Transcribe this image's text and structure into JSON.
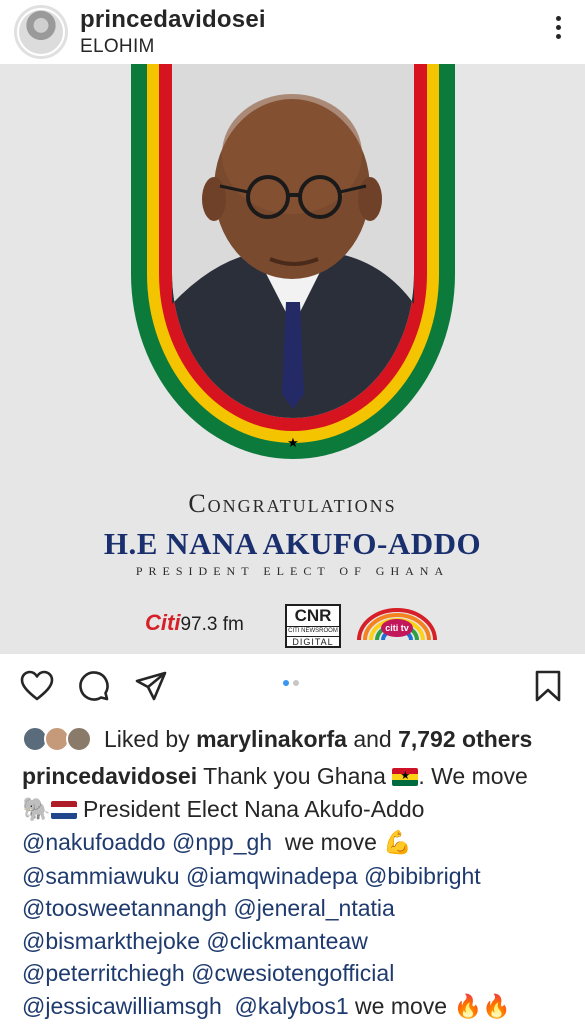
{
  "post": {
    "username": "princedavidosei",
    "location": "ELOHIM",
    "more_icon": "more-vertical-icon"
  },
  "image": {
    "congrats": "Congratulations",
    "name": "H.E NANA AKUFO-ADDO",
    "subtitle": "PRESIDENT ELECT OF GHANA",
    "logos": {
      "citi": "Citi",
      "citi_freq": "97.3 fm",
      "cnr": "CNR",
      "cnr_sub": "CITI NEWSROOM",
      "cnr_digital": "DIGITAL",
      "cititv": "citi tv"
    },
    "flag_colors": [
      "#ce1126",
      "#fcd116",
      "#006b3f"
    ]
  },
  "carousel": {
    "count": 2,
    "active": 0
  },
  "likes": {
    "prefix": "Liked by",
    "user": "marylinakorfa",
    "middle": "and",
    "count": "7,792 others"
  },
  "caption": {
    "username": "princedavidosei",
    "line1": "Thank you Ghana",
    "line1_end": ". We move",
    "line2": "President Elect Nana Akufo-Addo",
    "mention1": "@nakufoaddo",
    "mention2": "@npp_gh",
    "we_move": "we move",
    "mentions": [
      "@sammiawuku",
      "@iamqwinadepa",
      "@bibibright",
      "@toosweetannangh",
      "@jeneral_ntatia",
      "@bismarkthejoke",
      "@clickmanteaw",
      "@peterritchiegh",
      "@cwesiotengofficial",
      "@jessicawilliamsgh",
      "@kalybos1"
    ],
    "last": "we move"
  },
  "colors": {
    "mention": "#1e3a6e",
    "accent": "#3897f0"
  }
}
